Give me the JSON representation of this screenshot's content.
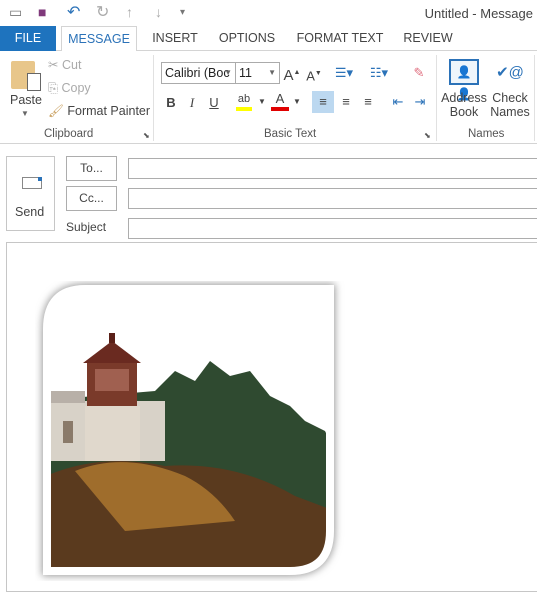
{
  "window": {
    "title": "Untitled - Message"
  },
  "qat": {
    "icons": [
      "outlook-icon",
      "save-icon",
      "undo-icon",
      "redo-icon",
      "up-icon",
      "down-icon",
      "customize-icon"
    ]
  },
  "tabs": [
    {
      "label": "FILE"
    },
    {
      "label": "MESSAGE"
    },
    {
      "label": "INSERT"
    },
    {
      "label": "OPTIONS"
    },
    {
      "label": "FORMAT TEXT"
    },
    {
      "label": "REVIEW"
    }
  ],
  "active_tab": "MESSAGE",
  "ribbon": {
    "clipboard": {
      "label": "Clipboard",
      "paste": "Paste",
      "cut": "Cut",
      "copy": "Copy",
      "format_painter": "Format Painter"
    },
    "basic_text": {
      "label": "Basic Text",
      "font": "Calibri (Boc",
      "size": "11",
      "bold": "B",
      "italic": "I",
      "underline": "U",
      "highlight_color": "#ffff00",
      "font_color": "#e00000"
    },
    "names": {
      "label": "Names",
      "address_book_1": "Address",
      "address_book_2": "Book",
      "check_names_1": "Check",
      "check_names_2": "Names"
    }
  },
  "compose": {
    "send": "Send",
    "to": "To...",
    "cc": "Cc...",
    "subject": "Subject",
    "to_value": "",
    "cc_value": "",
    "subject_value": ""
  }
}
